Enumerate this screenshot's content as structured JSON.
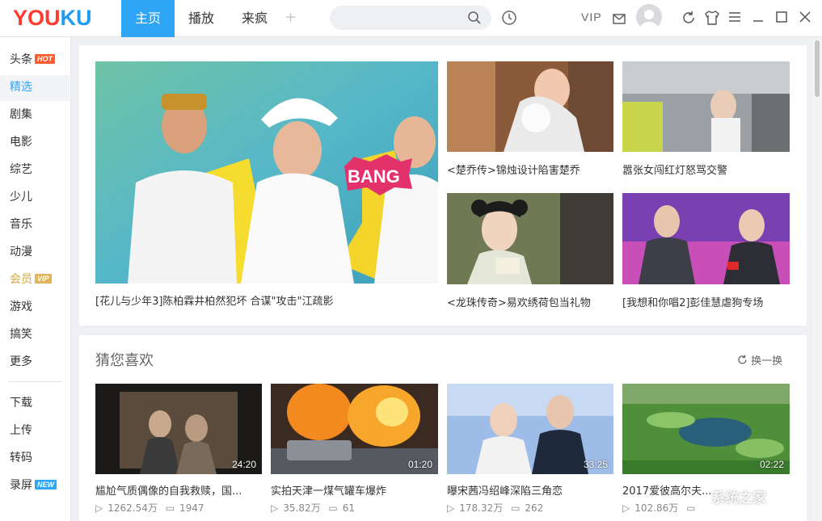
{
  "app": {
    "logo_part1": "YOU",
    "logo_part2": "KU",
    "brand_colors": {
      "red": "#ff3a2f",
      "blue": "#1f9cf0",
      "accent": "#2ea5f5"
    }
  },
  "header": {
    "tabs": [
      {
        "label": "主页",
        "active": true
      },
      {
        "label": "播放",
        "active": false
      },
      {
        "label": "来疯",
        "active": false
      }
    ],
    "add_tab": "+",
    "vip_label": "VIP",
    "icons": [
      "search-icon",
      "history-icon",
      "mail-icon",
      "avatar",
      "refresh-icon",
      "skin-icon",
      "menu-icon",
      "minimize-icon",
      "maximize-icon",
      "close-icon"
    ]
  },
  "sidebar": {
    "items": [
      {
        "label": "头条",
        "badge": "HOT"
      },
      {
        "label": "精选",
        "active": true
      },
      {
        "label": "剧集"
      },
      {
        "label": "电影"
      },
      {
        "label": "综艺"
      },
      {
        "label": "少儿"
      },
      {
        "label": "音乐"
      },
      {
        "label": "动漫"
      },
      {
        "label": "会员",
        "badge": "VIP"
      },
      {
        "label": "游戏"
      },
      {
        "label": "搞笑"
      },
      {
        "label": "更多"
      }
    ],
    "tools": [
      {
        "label": "下载"
      },
      {
        "label": "上传"
      },
      {
        "label": "转码"
      },
      {
        "label": "录屏",
        "badge": "NEW"
      }
    ]
  },
  "featured": {
    "main": {
      "caption": "[花儿与少年3]陈柏霖井柏然犯坏 合谋\"攻击\"江疏影"
    },
    "side": [
      {
        "caption": "<楚乔传>锦烛设计陷害楚乔"
      },
      {
        "caption": "嚣张女闯红灯怒骂交警"
      },
      {
        "caption": "<龙珠传奇>易欢绣荷包当礼物"
      },
      {
        "caption": "[我想和你唱2]彭佳慧虐狗专场"
      }
    ]
  },
  "recommend": {
    "title": "猜您喜欢",
    "refresh_label": "换一换",
    "videos": [
      {
        "title": "尴尬气质偶像的自我救赎，国...",
        "duration": "24:20",
        "views": "1262.54万",
        "comments": "1947"
      },
      {
        "title": "实拍天津一煤气罐车爆炸",
        "duration": "01:20",
        "views": "35.82万",
        "comments": "61"
      },
      {
        "title": "曝宋茜冯绍峰深陷三角恋",
        "duration": "33:25",
        "views": "178.32万",
        "comments": "262"
      },
      {
        "title": "2017爱彼高尔夫...",
        "duration": "02:22",
        "views": "102.86万",
        "comments": ""
      }
    ]
  },
  "watermark": "系统之家"
}
